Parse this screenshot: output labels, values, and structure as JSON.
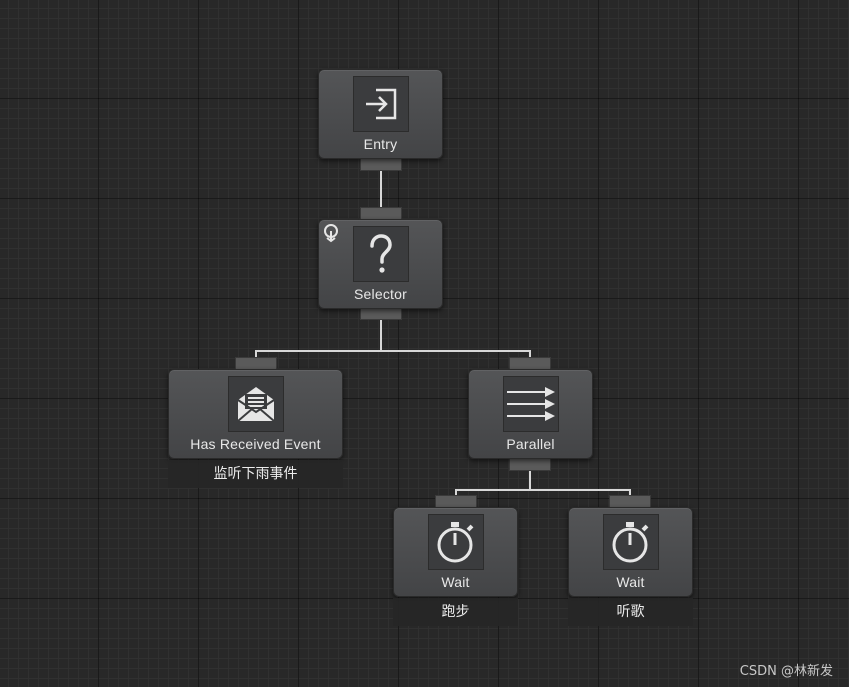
{
  "nodes": {
    "entry": {
      "label": "Entry",
      "icon": "entry-arrow-icon"
    },
    "selector": {
      "label": "Selector",
      "icon": "question-mark-icon",
      "badge_icon": "conditional-abort-icon"
    },
    "has_received_event": {
      "label": "Has Received Event",
      "icon": "envelope-icon",
      "comment": "监听下雨事件"
    },
    "parallel": {
      "label": "Parallel",
      "icon": "parallel-arrows-icon"
    },
    "wait_run": {
      "label": "Wait",
      "icon": "stopwatch-icon",
      "comment": "跑步"
    },
    "wait_music": {
      "label": "Wait",
      "icon": "stopwatch-icon",
      "comment": "听歌"
    }
  },
  "watermark": "CSDN @林新发",
  "colors": {
    "background": "#282828",
    "node": "#4b4c4e",
    "connector": "#d8d8d8"
  }
}
